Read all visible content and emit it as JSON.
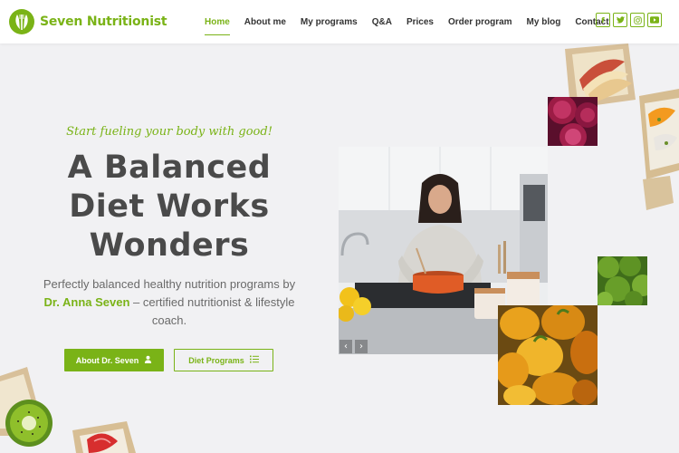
{
  "brand": {
    "name": "Seven Nutritionist",
    "accent": "#7ab317",
    "logo_icon": "leaf-fork-icon"
  },
  "nav": {
    "items": [
      {
        "label": "Home",
        "active": true
      },
      {
        "label": "About me",
        "active": false
      },
      {
        "label": "My programs",
        "active": false
      },
      {
        "label": "Q&A",
        "active": false
      },
      {
        "label": "Prices",
        "active": false
      },
      {
        "label": "Order program",
        "active": false
      },
      {
        "label": "My blog",
        "active": false
      },
      {
        "label": "Contact",
        "active": false
      }
    ]
  },
  "social": [
    {
      "icon": "facebook-icon",
      "glyph": "f"
    },
    {
      "icon": "twitter-icon",
      "glyph": "𝕥"
    },
    {
      "icon": "instagram-icon",
      "glyph": "◎"
    },
    {
      "icon": "youtube-icon",
      "glyph": "▶"
    }
  ],
  "hero": {
    "tagline": "Start fueling your body with good!",
    "headline": [
      "A Balanced",
      "Diet Works",
      "Wonders"
    ],
    "description_pre": "Perfectly balanced healthy nutrition programs by ",
    "description_name": "Dr. Anna Seven",
    "description_post": " – certified nutritionist & lifestyle coach.",
    "buttons": {
      "primary": {
        "label": "About Dr. Seven",
        "icon": "user-badge-icon"
      },
      "secondary": {
        "label": "Diet Programs",
        "icon": "list-icon"
      }
    }
  },
  "slider": {
    "prev_icon": "chevron-left-icon",
    "next_icon": "chevron-right-icon"
  }
}
